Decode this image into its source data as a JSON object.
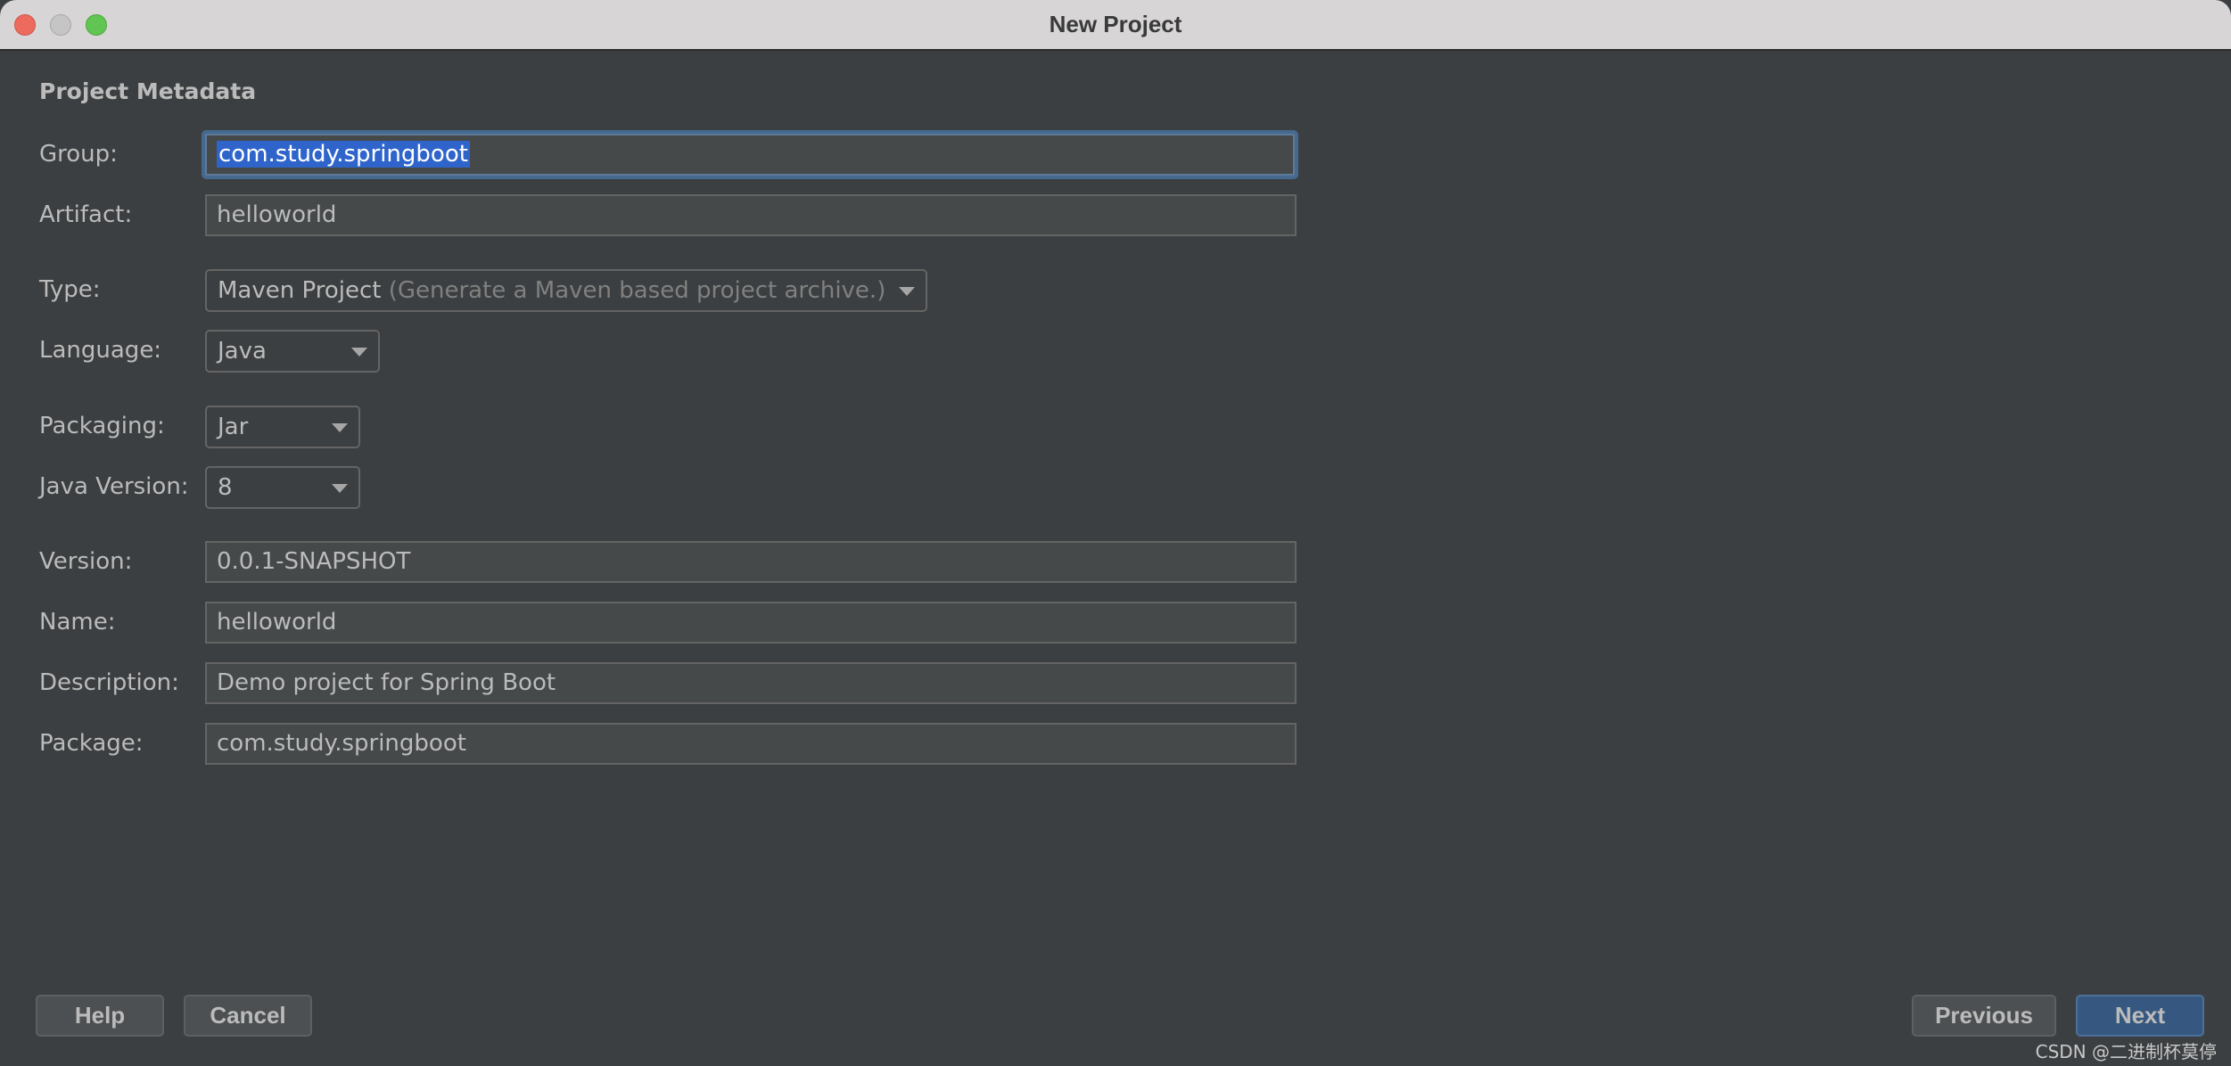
{
  "window": {
    "title": "New Project",
    "controls": [
      "close",
      "minimize",
      "maximize"
    ]
  },
  "section": {
    "title": "Project Metadata"
  },
  "form": {
    "group": {
      "label": "Group:",
      "value": "com.study.springboot",
      "focused": true,
      "selected": true
    },
    "artifact": {
      "label": "Artifact:",
      "value": "helloworld"
    },
    "type": {
      "label": "Type:",
      "value": "Maven Project",
      "hint": "(Generate a Maven based project archive.)"
    },
    "language": {
      "label": "Language:",
      "value": "Java"
    },
    "packaging": {
      "label": "Packaging:",
      "value": "Jar"
    },
    "java_version": {
      "label": "Java Version:",
      "value": "8"
    },
    "version": {
      "label": "Version:",
      "value": "0.0.1-SNAPSHOT"
    },
    "name": {
      "label": "Name:",
      "value": "helloworld"
    },
    "description": {
      "label": "Description:",
      "value": "Demo project for Spring Boot"
    },
    "package": {
      "label": "Package:",
      "value": "com.study.springboot"
    }
  },
  "buttons": {
    "help": "Help",
    "cancel": "Cancel",
    "previous": "Previous",
    "next": "Next"
  },
  "watermark": "CSDN @二进制杯莫停",
  "colors": {
    "background": "#3c3f41",
    "field_background": "#45494a",
    "selection": "#2f65ca",
    "focus_ring": "#46698f",
    "primary_button": "#365880",
    "titlebar": "#d7d5d6"
  }
}
